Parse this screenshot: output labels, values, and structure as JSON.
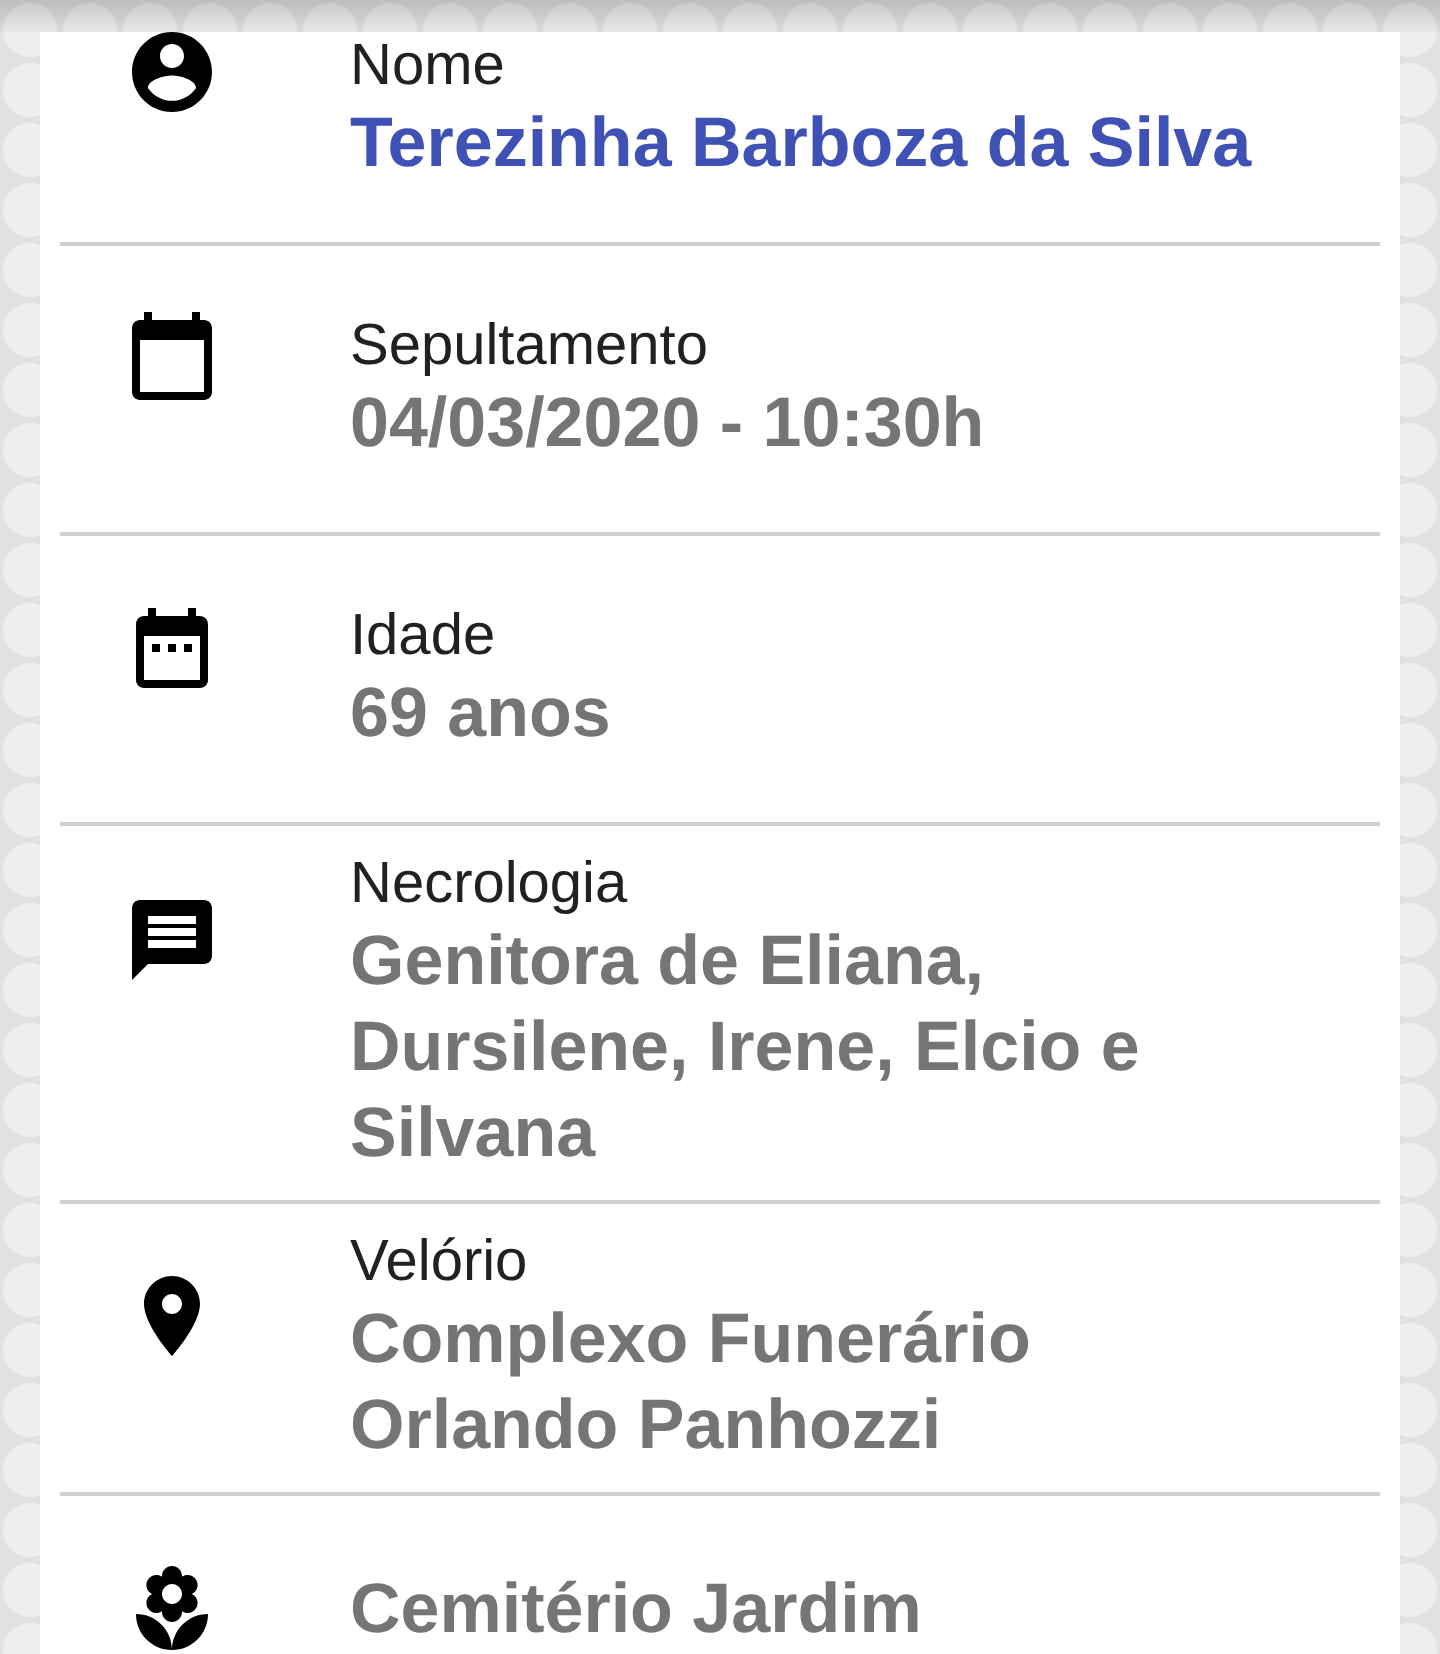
{
  "fields": [
    {
      "kind": "name",
      "label": "Nome",
      "value": "Terezinha Barboza da Silva",
      "color": "#3f51b5"
    },
    {
      "kind": "burial",
      "label": "Sepultamento",
      "value": "04/03/2020 - 10:30h",
      "color": "#757575"
    },
    {
      "kind": "age",
      "label": "Idade",
      "value": "69 anos",
      "color": "#757575"
    },
    {
      "kind": "obituary",
      "label": "Necrologia",
      "value": "Genitora de Eliana, Dursilene, Irene, Elcio e Silvana",
      "color": "#757575"
    },
    {
      "kind": "wake",
      "label": "Velório",
      "value": "Complexo Funerário Orlando Panhozzi",
      "color": "#757575"
    },
    {
      "kind": "cemetery",
      "value": "Cemitério Jardim",
      "color": "#757575"
    }
  ]
}
